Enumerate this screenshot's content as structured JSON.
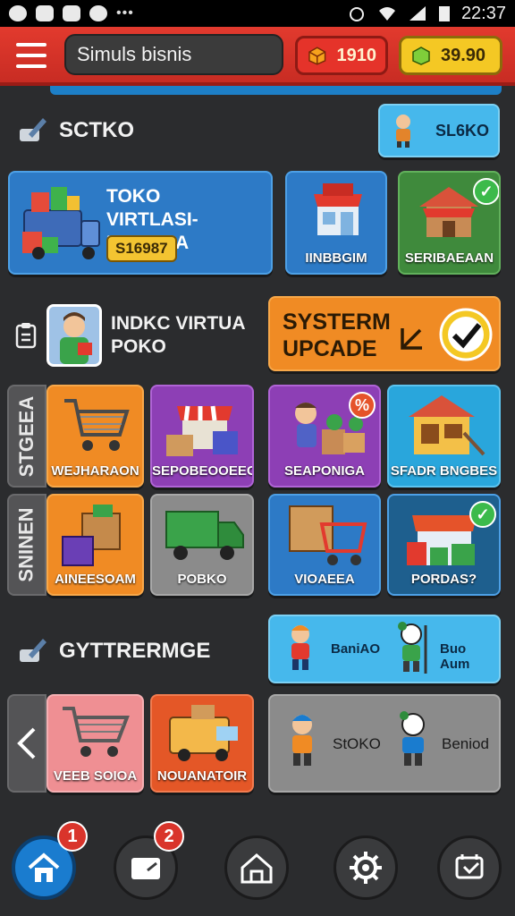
{
  "status_bar": {
    "time": "22:37"
  },
  "top_bar": {
    "search_placeholder": "Simuls bisnis",
    "stat_red_value": "1910",
    "stat_yellow_value": "39.90"
  },
  "section1": {
    "title": "SCTKO",
    "side_button_label": "SL6KO",
    "featured": {
      "title_line1": "TOKO",
      "title_line2": "VIRTLASI-IINAASIA",
      "price": "S16987"
    },
    "tiles": [
      {
        "label": "IINBBGIM"
      },
      {
        "label": "SERIBAEAAN"
      }
    ]
  },
  "section2": {
    "title_line1": "INDKC VIRTUA",
    "title_line2": "POKO",
    "upgrade_line1": "SYSTERM",
    "upgrade_line2": "UPCADE",
    "side_tab_1": "STGEEA",
    "side_tab_2": "SNINEN",
    "grid_row1": [
      {
        "label": "WEJHARAON"
      },
      {
        "label": "SEPOBEOOEEOM"
      },
      {
        "label": "SEAPONIGA"
      },
      {
        "label": "SFADR BNGBES"
      }
    ],
    "grid_row2": [
      {
        "label": "AINEESOAM"
      },
      {
        "label": "POBKO"
      },
      {
        "label": "VIOAEEA"
      },
      {
        "label": "PORDAS?"
      }
    ]
  },
  "section3": {
    "title": "GYTTRERMGE",
    "char_card_top": {
      "label_left": "BaniAO",
      "label_right": "Buo Aum"
    },
    "row": [
      {
        "label": "VEEB SOIOA"
      },
      {
        "label": "NOUANATOIR"
      }
    ],
    "char_card_bottom": {
      "label_left": "StOKO",
      "label_right": "Beniod"
    }
  },
  "bottom_nav": {
    "badge1": "1",
    "badge2": "2"
  },
  "colors": {
    "accent_red": "#e23a2e",
    "accent_blue": "#1a7ccf",
    "accent_yellow": "#f4c824"
  }
}
